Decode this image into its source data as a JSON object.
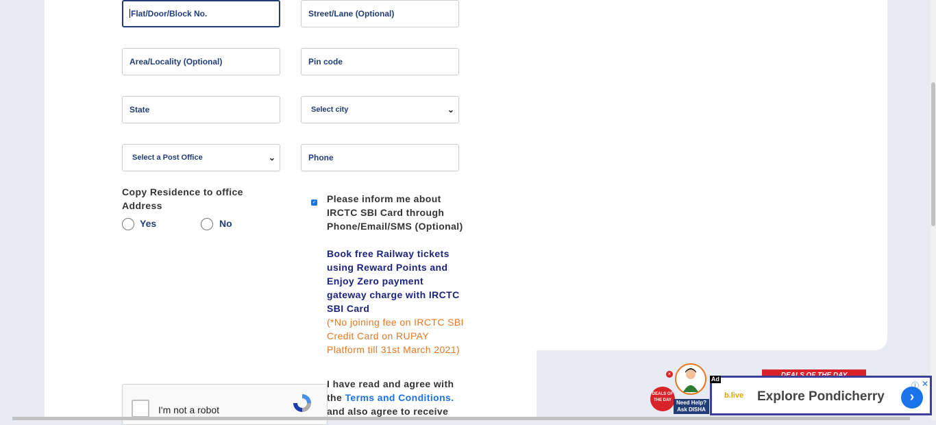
{
  "address_form": {
    "flat_placeholder": "Flat/Door/Block No.",
    "street_placeholder": "Street/Lane (Optional)",
    "area_placeholder": "Area/Locality (Optional)",
    "pincode_placeholder": "Pin code",
    "state_placeholder": "State",
    "city_select": "Select city",
    "post_office_select": "Select a Post Office",
    "phone_placeholder": "Phone"
  },
  "copy_residence": {
    "label": "Copy Residence to office Address",
    "yes": "Yes",
    "no": "No"
  },
  "sbi_card": {
    "checked": true,
    "inform_text": "Please inform me about IRCTC SBI Card through Phone/Email/SMS (Optional)",
    "promo_text": "Book free Railway tickets using Reward Points and Enjoy Zero payment gateway charge with IRCTC SBI Card",
    "offer_text": "(*No joining fee on IRCTC SBI Credit Card on RUPAY Platform till 31st March 2021)"
  },
  "terms": {
    "prefix": "I have read and agree with the",
    "link": "Terms and Conditions.",
    "suffix": "and also agree to receive"
  },
  "captcha": {
    "label": "I'm not a robot"
  },
  "disha": {
    "help_line1": "Need Help?",
    "help_line2": "Ask DISHA"
  },
  "deals": {
    "badge_text": "DEALS OF THE DAY",
    "banner_text": "DEALS OF THE DAY"
  },
  "ad": {
    "tag": "Ad",
    "logo_text": "b.live",
    "title": "Explore Pondicherry"
  },
  "colors": {
    "navy": "#213d77",
    "orange": "#e87722",
    "link_blue": "#1a73e8",
    "background": "#e8ebf3"
  }
}
